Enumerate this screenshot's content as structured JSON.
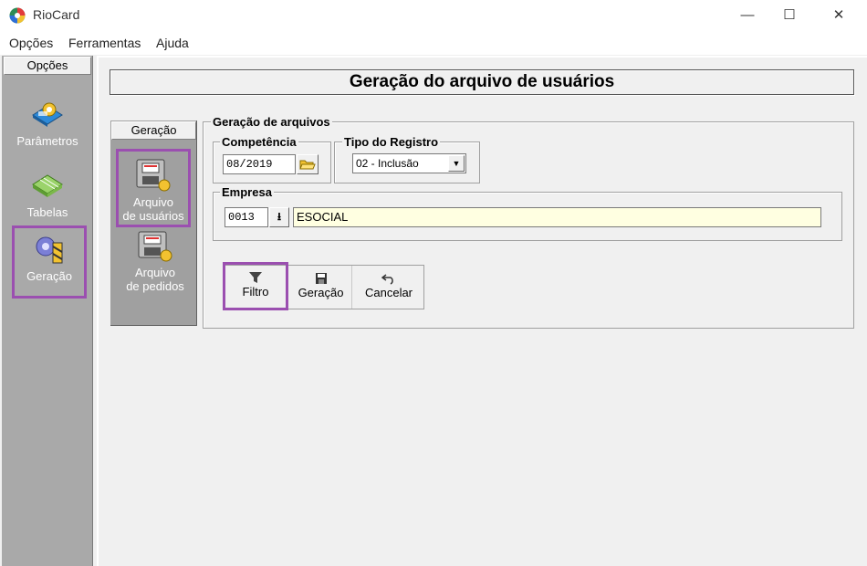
{
  "window": {
    "title": "RioCard",
    "minimize": "—",
    "maximize": "☐",
    "close": "✕"
  },
  "menu": [
    "Opções",
    "Ferramentas",
    "Ajuda"
  ],
  "sidebar": {
    "header": "Opções",
    "items": [
      {
        "label": "Parâmetros",
        "icon": "parameters-icon"
      },
      {
        "label": "Tabelas",
        "icon": "tables-icon"
      },
      {
        "label": "Geração",
        "icon": "generation-icon",
        "selected": true
      }
    ]
  },
  "page": {
    "title": "Geração do arquivo de usuários"
  },
  "geracao_nav": {
    "tab": "Geração",
    "items": [
      {
        "line1": "Arquivo",
        "line2": "de usuários",
        "selected": true
      },
      {
        "line1": "Arquivo",
        "line2": "de pedidos"
      }
    ]
  },
  "form": {
    "group_title": "Geração de arquivos",
    "competencia": {
      "label": "Competência",
      "value": "08/2019"
    },
    "tipo_registro": {
      "label": "Tipo do Registro",
      "value": "02 - Inclusão"
    },
    "empresa": {
      "label": "Empresa",
      "code": "0013",
      "name": "ESOCIAL"
    }
  },
  "toolbar": {
    "filtro": "Filtro",
    "geracao": "Geração",
    "cancelar": "Cancelar"
  },
  "colors": {
    "highlight": "#9b4fb0",
    "sidebar": "#a9a9a9",
    "name_field": "#ffffe1"
  }
}
